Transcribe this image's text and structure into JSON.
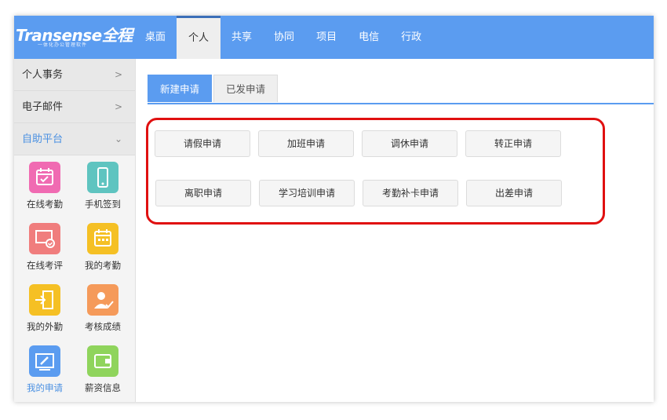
{
  "logo": {
    "main": "Transense全程",
    "sub": "一体化办公管理软件"
  },
  "nav": {
    "items": [
      "桌面",
      "个人",
      "共享",
      "协同",
      "项目",
      "电信",
      "行政"
    ],
    "active": "个人"
  },
  "sidebar": {
    "menus": [
      {
        "label": "个人事务",
        "chevron": ">"
      },
      {
        "label": "电子邮件",
        "chevron": ">"
      },
      {
        "label": "自助平台",
        "chevron": "⌄"
      }
    ],
    "apps": [
      {
        "label": "在线考勤",
        "icon": "calendar-icon",
        "color": "#f06bb2"
      },
      {
        "label": "手机签到",
        "icon": "mobile-phone-icon",
        "color": "#5fc4c0"
      },
      {
        "label": "在线考评",
        "icon": "screen-check-icon",
        "color": "#f07d7d"
      },
      {
        "label": "我的考勤",
        "icon": "calendar-icon",
        "color": "#f5c024"
      },
      {
        "label": "我的外勤",
        "icon": "exit-door-icon",
        "color": "#f5c024"
      },
      {
        "label": "考核成绩",
        "icon": "user-check-icon",
        "color": "#f59a5a"
      },
      {
        "label": "我的申请",
        "icon": "edit-screen-icon",
        "color": "#5b9cf0"
      },
      {
        "label": "薪资信息",
        "icon": "wallet-icon",
        "color": "#8fd45c"
      }
    ],
    "active_app": "我的申请"
  },
  "tabs": {
    "items": [
      "新建申请",
      "已发申请"
    ],
    "active": "新建申请"
  },
  "buttons": {
    "row1": [
      "请假申请",
      "加班申请",
      "调休申请",
      "转正申请"
    ],
    "row2": [
      "离职申请",
      "学习培训申请",
      "考勤补卡申请",
      "出差申请"
    ]
  },
  "colors": {
    "brand": "#5b9cf0",
    "highlight": "#e01010"
  }
}
